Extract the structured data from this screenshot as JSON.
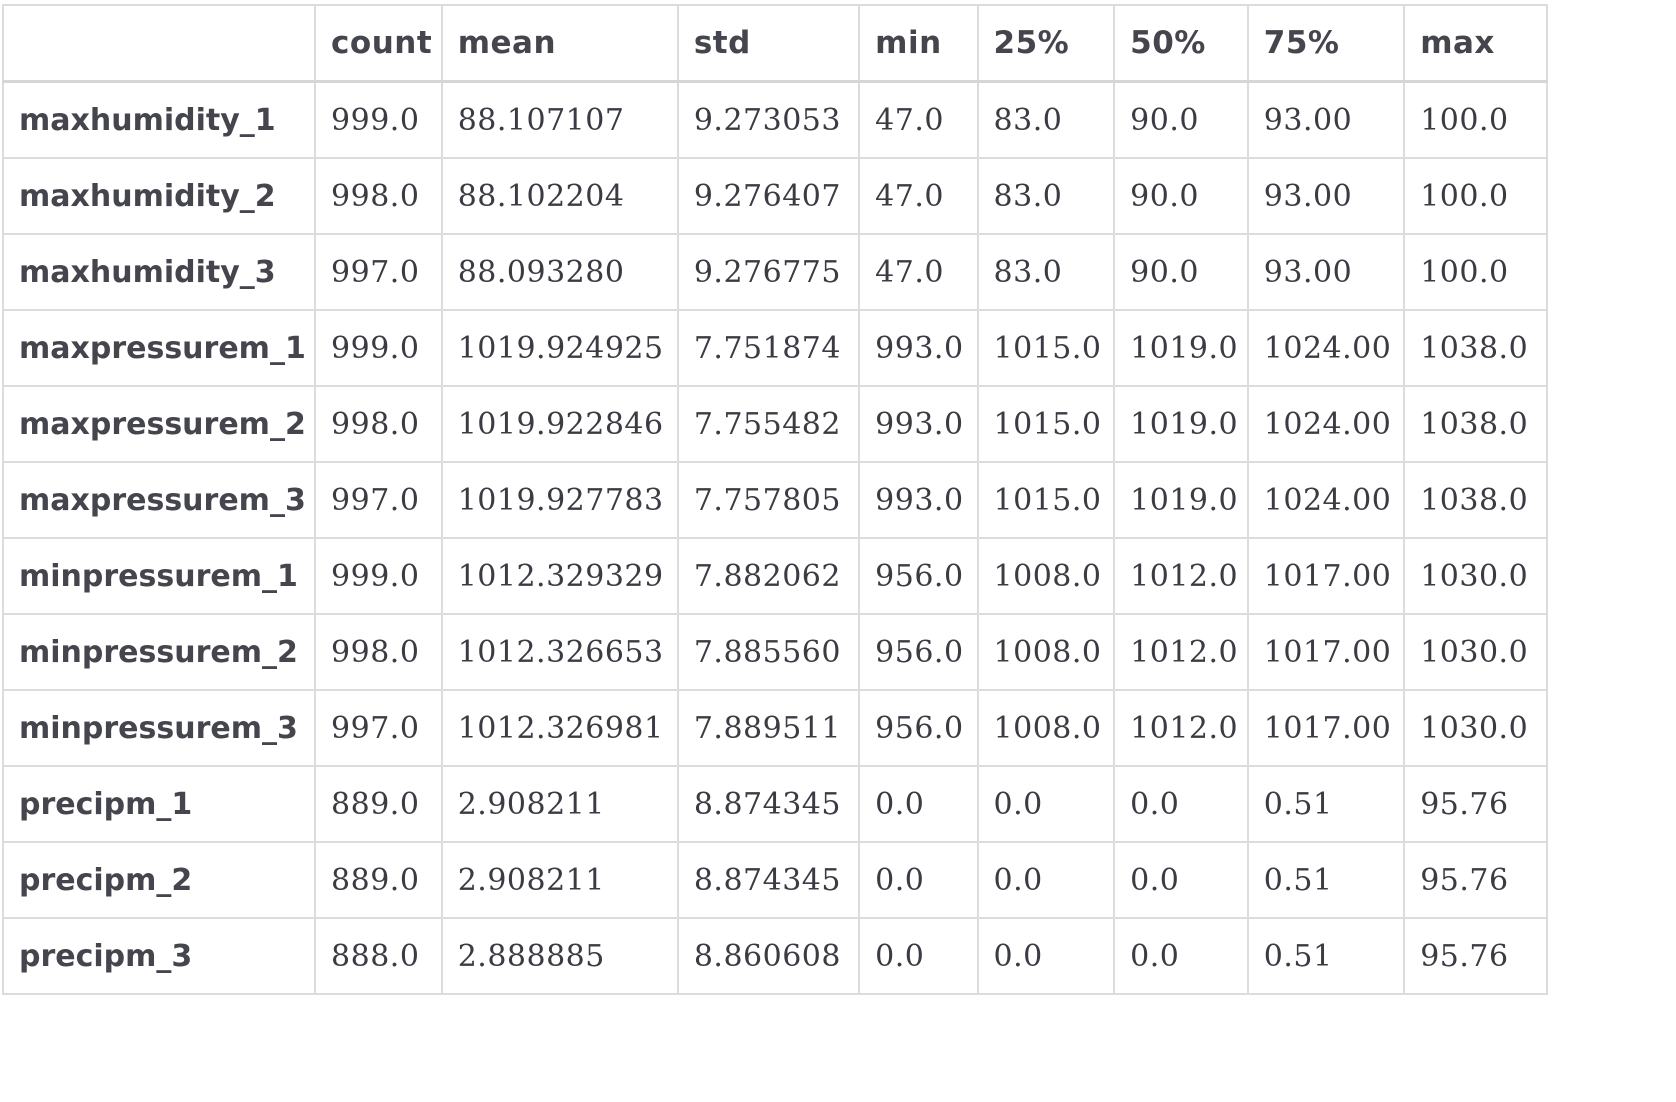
{
  "table": {
    "columns": [
      "count",
      "mean",
      "std",
      "min",
      "25%",
      "50%",
      "75%",
      "max"
    ],
    "rows": [
      {
        "label": "maxhumidity_1",
        "values": [
          "999.0",
          "88.107107",
          "9.273053",
          "47.0",
          "83.0",
          "90.0",
          "93.00",
          "100.0"
        ]
      },
      {
        "label": "maxhumidity_2",
        "values": [
          "998.0",
          "88.102204",
          "9.276407",
          "47.0",
          "83.0",
          "90.0",
          "93.00",
          "100.0"
        ]
      },
      {
        "label": "maxhumidity_3",
        "values": [
          "997.0",
          "88.093280",
          "9.276775",
          "47.0",
          "83.0",
          "90.0",
          "93.00",
          "100.0"
        ]
      },
      {
        "label": "maxpressurem_1",
        "values": [
          "999.0",
          "1019.924925",
          "7.751874",
          "993.0",
          "1015.0",
          "1019.0",
          "1024.00",
          "1038.0"
        ]
      },
      {
        "label": "maxpressurem_2",
        "values": [
          "998.0",
          "1019.922846",
          "7.755482",
          "993.0",
          "1015.0",
          "1019.0",
          "1024.00",
          "1038.0"
        ]
      },
      {
        "label": "maxpressurem_3",
        "values": [
          "997.0",
          "1019.927783",
          "7.757805",
          "993.0",
          "1015.0",
          "1019.0",
          "1024.00",
          "1038.0"
        ]
      },
      {
        "label": "minpressurem_1",
        "values": [
          "999.0",
          "1012.329329",
          "7.882062",
          "956.0",
          "1008.0",
          "1012.0",
          "1017.00",
          "1030.0"
        ]
      },
      {
        "label": "minpressurem_2",
        "values": [
          "998.0",
          "1012.326653",
          "7.885560",
          "956.0",
          "1008.0",
          "1012.0",
          "1017.00",
          "1030.0"
        ]
      },
      {
        "label": "minpressurem_3",
        "values": [
          "997.0",
          "1012.326981",
          "7.889511",
          "956.0",
          "1008.0",
          "1012.0",
          "1017.00",
          "1030.0"
        ]
      },
      {
        "label": "precipm_1",
        "values": [
          "889.0",
          "2.908211",
          "8.874345",
          "0.0",
          "0.0",
          "0.0",
          "0.51",
          "95.76"
        ]
      },
      {
        "label": "precipm_2",
        "values": [
          "889.0",
          "2.908211",
          "8.874345",
          "0.0",
          "0.0",
          "0.0",
          "0.51",
          "95.76"
        ]
      },
      {
        "label": "precipm_3",
        "values": [
          "888.0",
          "2.888885",
          "8.860608",
          "0.0",
          "0.0",
          "0.0",
          "0.51",
          "95.76"
        ]
      }
    ]
  }
}
